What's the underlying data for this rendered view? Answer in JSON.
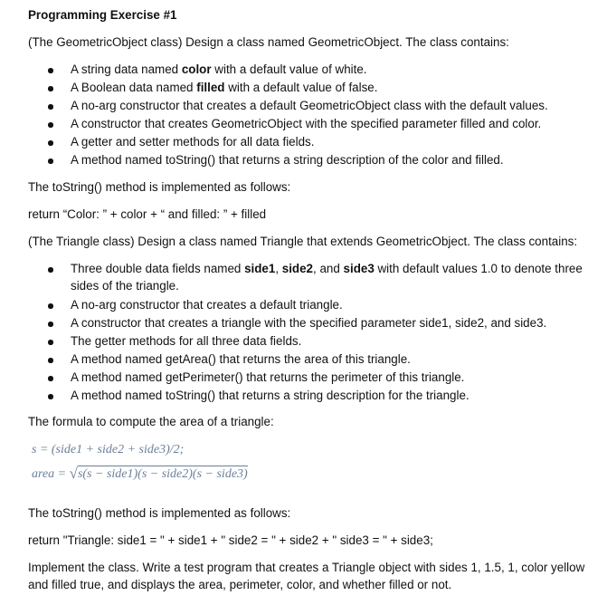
{
  "title": "Programming Exercise #1",
  "geometric_intro": "(The GeometricObject class) Design a class named GeometricObject. The class contains:",
  "geometric_bullets": [
    {
      "pre": "A string data named ",
      "bold": "color",
      "post": " with a default value of white."
    },
    {
      "pre": "A Boolean data named ",
      "bold": "filled",
      "post": " with a default value of false."
    },
    {
      "pre": "A no-arg constructor that creates a default GeometricObject class with the default values.",
      "bold": "",
      "post": ""
    },
    {
      "pre": "A constructor that creates GeometricObject with the specified parameter filled and color.",
      "bold": "",
      "post": ""
    },
    {
      "pre": "A getter and setter methods for all data fields.",
      "bold": "",
      "post": ""
    },
    {
      "pre": "A method named toString() that returns a string description of the color and filled.",
      "bold": "",
      "post": ""
    }
  ],
  "tostring_note_1": "The toString() method is implemented as follows:",
  "return_1": "return “Color: ” + color + “ and filled: ” + filled",
  "triangle_intro": "(The Triangle class) Design a class named Triangle that extends GeometricObject. The class contains:",
  "triangle_first_bullet": {
    "t1": "Three double data fields named ",
    "b1": "side1",
    "t2": ", ",
    "b2": "side2",
    "t3": ", and ",
    "b3": "side3",
    "t4": " with default values 1.0 to denote three",
    "t5": "sides of the triangle."
  },
  "triangle_bullets": [
    "A no-arg constructor that creates a default triangle.",
    "A constructor that creates a triangle with the specified parameter side1, side2, and side3.",
    "The getter methods for all three data fields.",
    "A method named getArea() that returns the area of this triangle.",
    "A method named getPerimeter() that returns the perimeter of this triangle.",
    "A method named toString() that returns a string description for the triangle."
  ],
  "formula_intro": "The formula to compute the area of a triangle:",
  "formula_s": "s = (side1 + side2 + side3)/2;",
  "formula_area_lhs": "area = ",
  "formula_area_radicand": "s(s − side1)(s − side2)(s − side3)",
  "tostring_note_2": "The toString() method is implemented as follows:",
  "return_2": "return \"Triangle: side1 = \" + side1 + \" side2 = \" + side2 + \" side3 = \" + side3;",
  "implement_line_1": "Implement the class. Write a test program that creates a Triangle object with sides 1, 1.5, 1, color yellow",
  "implement_line_2": "and filled true, and displays the area, perimeter, color, and whether filled or not."
}
